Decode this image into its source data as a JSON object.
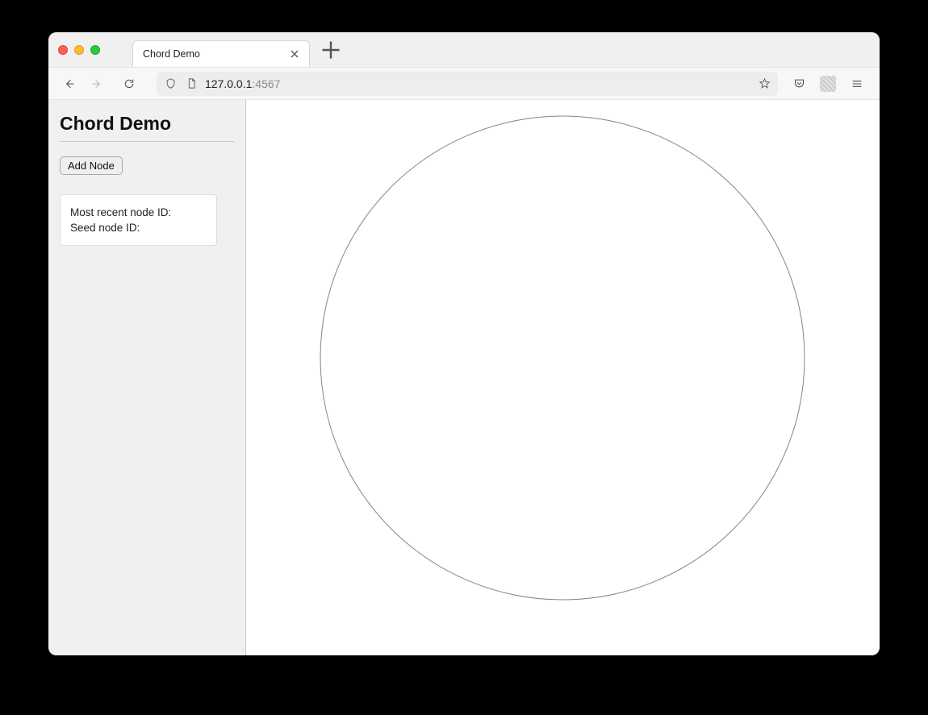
{
  "browser": {
    "tab_title": "Chord Demo",
    "url_host": "127.0.0.1",
    "url_port": ":4567"
  },
  "sidebar": {
    "title": "Chord Demo",
    "add_button_label": "Add Node",
    "info": {
      "recent_label": "Most recent node ID:",
      "recent_value": "",
      "seed_label": "Seed node ID:",
      "seed_value": ""
    }
  }
}
